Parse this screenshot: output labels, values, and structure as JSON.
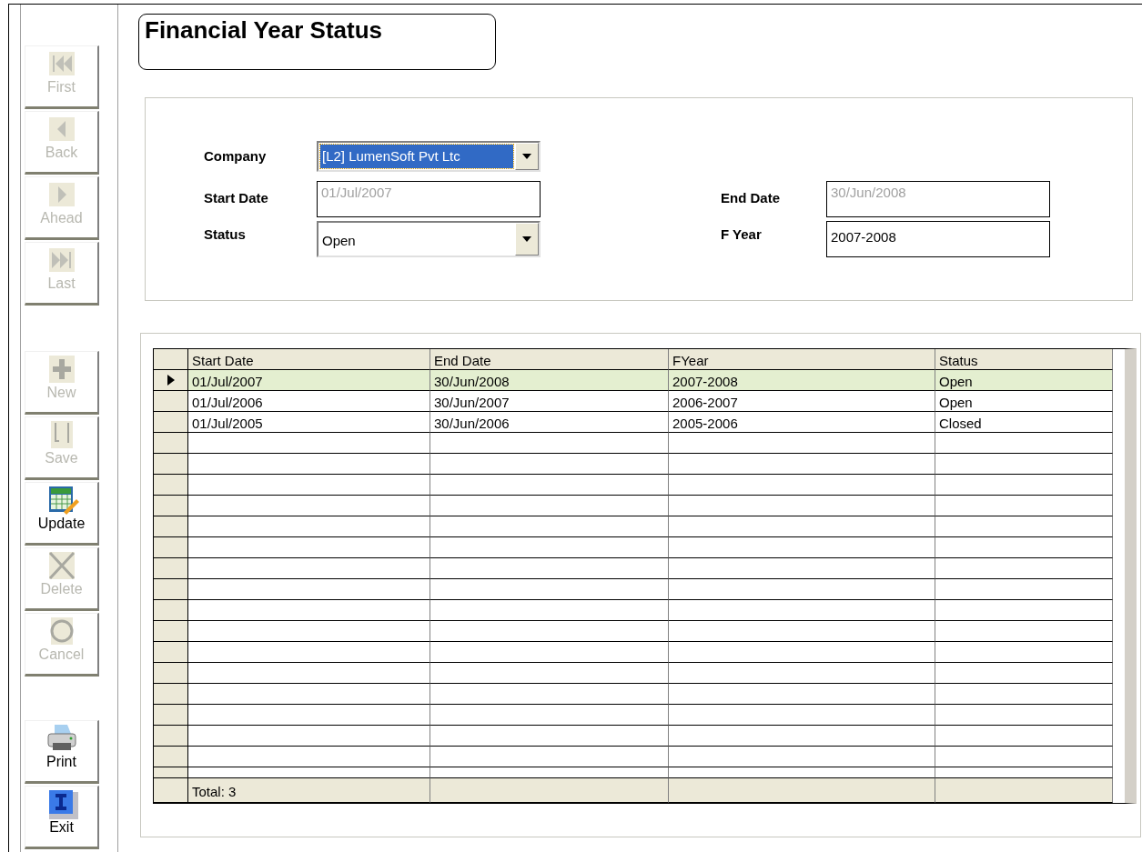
{
  "toolbar": [
    {
      "label": "First",
      "kind": "first",
      "disabled": true
    },
    {
      "label": "Back",
      "kind": "back",
      "disabled": true
    },
    {
      "label": "Ahead",
      "kind": "ahead",
      "disabled": true
    },
    {
      "label": "Last",
      "kind": "last",
      "disabled": true
    },
    {
      "label": "New",
      "kind": "new",
      "disabled": true
    },
    {
      "label": "Save",
      "kind": "save",
      "disabled": true
    },
    {
      "label": "Update",
      "kind": "update",
      "disabled": false
    },
    {
      "label": "Delete",
      "kind": "delete",
      "disabled": true
    },
    {
      "label": "Cancel",
      "kind": "cancel",
      "disabled": true
    },
    {
      "label": "Print",
      "kind": "print",
      "disabled": false
    },
    {
      "label": "Exit",
      "kind": "exit",
      "disabled": false
    }
  ],
  "title": "Financial Year Status",
  "form": {
    "company": {
      "label": "Company",
      "value": "[L2] LumenSoft Pvt Ltc",
      "selected": true
    },
    "start_date": {
      "label": "Start Date",
      "value": "01/Jul/2007",
      "disabled": true
    },
    "end_date": {
      "label": "End Date",
      "value": "30/Jun/2008",
      "disabled": true
    },
    "status": {
      "label": "Status",
      "value": "Open"
    },
    "f_year": {
      "label": "F Year",
      "value": "2007-2008"
    }
  },
  "table": {
    "columns": [
      "Start Date",
      "End Date",
      "FYear",
      "Status"
    ],
    "rows": [
      {
        "cells": [
          "01/Jul/2007",
          "30/Jun/2008",
          "2007-2008",
          "Open"
        ],
        "selected": true
      },
      {
        "cells": [
          "01/Jul/2006",
          "30/Jun/2007",
          "2006-2007",
          "Open"
        ],
        "selected": false
      },
      {
        "cells": [
          "01/Jul/2005",
          "30/Jun/2006",
          "2005-2006",
          "Closed"
        ],
        "selected": false
      }
    ],
    "footer": "Total: 3"
  }
}
